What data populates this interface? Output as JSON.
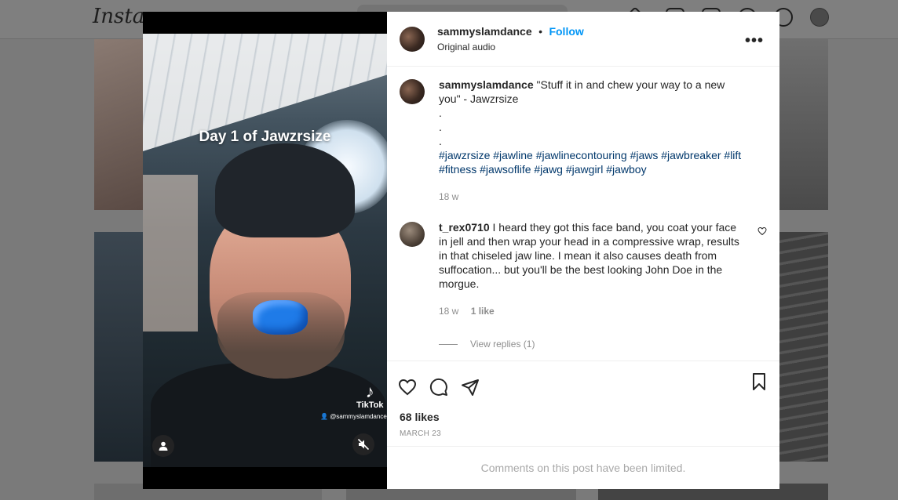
{
  "background": {
    "logo": "Instagram"
  },
  "video": {
    "overlay_title": "Day 1 of Jawzrsize",
    "tiktok_label": "TikTok",
    "tiktok_user": "@sammyslamdance",
    "profile_icon": "person-icon",
    "mute_icon": "speaker-muted-icon"
  },
  "post": {
    "username": "sammyslamdance",
    "separator": "•",
    "follow_label": "Follow",
    "audio": "Original audio",
    "more_label": "•••"
  },
  "caption": {
    "username": "sammyslamdance",
    "text": "\"Stuff it in and chew your way to a new you\" - Jawzrsize",
    "dots": [
      ".",
      ".",
      "."
    ],
    "hashtags_line1": "#jawzrsize #jawline #jawlinecontouring #jaws #jawbreaker #lift",
    "hashtags_line2": "#fitness #jawsoflife #jawg #jawgirl #jawboy",
    "time": "18 w"
  },
  "comments": [
    {
      "username": "t_rex0710",
      "text": "I heard they got this face band, you coat your face in jell and then wrap your head in a compressive wrap, results in that chiseled jaw line. I mean it also causes death from suffocation... but you'll be the best looking John Doe in the morgue.",
      "time": "18 w",
      "likes": "1 like",
      "view_replies": "View replies (1)"
    }
  ],
  "actions": {
    "likes": "68 likes",
    "date": "MARCH 23",
    "limited_text": "Comments on this post have been limited."
  }
}
